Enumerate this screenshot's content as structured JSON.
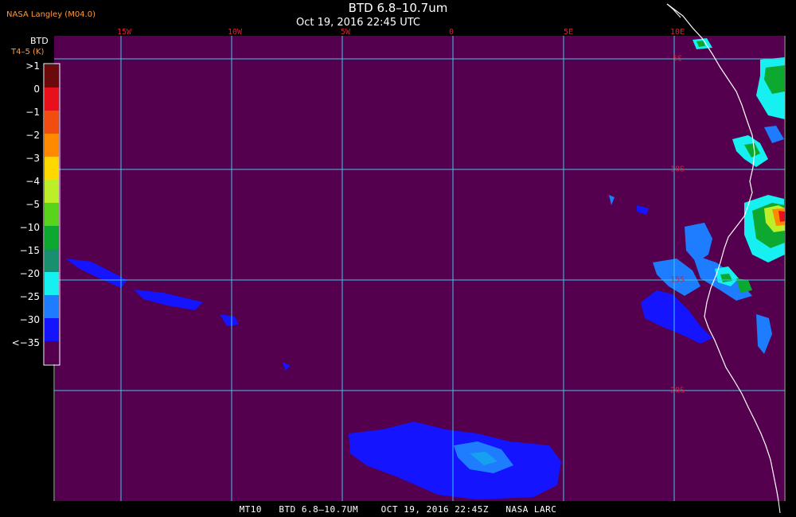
{
  "header": {
    "title": "BTD 6.8–10.7um",
    "subtitle": "Oct 19, 2016 22:45 UTC",
    "producer": "NASA Langley (M04.0)"
  },
  "legend": {
    "title": "BTD",
    "units": "T4–5 (K)",
    "entries": [
      {
        "label": ">1",
        "color": "#6b0a0a"
      },
      {
        "label": "0",
        "color": "#e8101a"
      },
      {
        "label": "−1",
        "color": "#f24d10"
      },
      {
        "label": "−2",
        "color": "#ff8a00"
      },
      {
        "label": "−3",
        "color": "#ffd800"
      },
      {
        "label": "−4",
        "color": "#bcef2a"
      },
      {
        "label": "−5",
        "color": "#58d41c"
      },
      {
        "label": "−10",
        "color": "#0da830"
      },
      {
        "label": "−15",
        "color": "#189070"
      },
      {
        "label": "−20",
        "color": "#16f0f0"
      },
      {
        "label": "−25",
        "color": "#1e7cff"
      },
      {
        "label": "−30",
        "color": "#1414ff"
      },
      {
        "label": "<−35",
        "color": "#55004f"
      }
    ]
  },
  "map": {
    "longitude_labels": [
      "15W",
      "10W",
      "5W",
      "0",
      "5E",
      "10E"
    ],
    "latitude_labels": [
      "5S",
      "10S",
      "15S",
      "20S"
    ],
    "colors": {
      "background": "#55004f",
      "grid": "#3fc6e0",
      "coast": "#ffffff",
      "label": "#d4203a"
    }
  },
  "footer": "MT10   BTD 6.8–10.7UM    OCT 19, 2016 22:45Z   NASA LARC"
}
